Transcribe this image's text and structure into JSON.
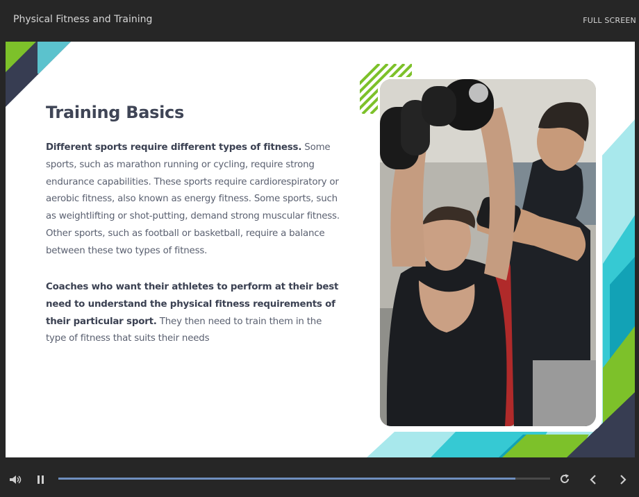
{
  "player": {
    "course_title": "Physical Fitness and Training",
    "fullscreen_label": "FULL SCREEN"
  },
  "slide": {
    "title": "Training Basics",
    "paragraph1_bold": "Different sports require different types of fitness.",
    "paragraph1_text": " Some sports, such as marathon running or cycling, require strong endurance capabilities. These sports require cardiorespiratory or aerobic fitness, also known as energy fitness. Some sports, such as weightlifting or shot-putting, demand strong muscular fitness. Other sports, such as football or basketball, require a balance between these two types of fitness.",
    "paragraph2_bold": "Coaches who want their athletes to perform at their best need to understand the physical fitness requirements of their particular sport.",
    "paragraph2_text": " They then need to train them in the type of fitness that suits their needs",
    "photo_icon": "trainer-spotting-athlete-photo"
  },
  "controls": {
    "volume_icon": "volume-icon",
    "pause_icon": "pause-icon",
    "replay_icon": "replay-icon",
    "prev_icon": "chevron-left-icon",
    "next_icon": "chevron-right-icon",
    "progress_fraction": 0.93
  },
  "colors": {
    "navy": "#373d52",
    "lime": "#7dc12a",
    "cyan": "#36c9d3",
    "light_cyan": "#a8e8ec",
    "teal": "#12a2b6",
    "progress": "#6f8fbf"
  }
}
